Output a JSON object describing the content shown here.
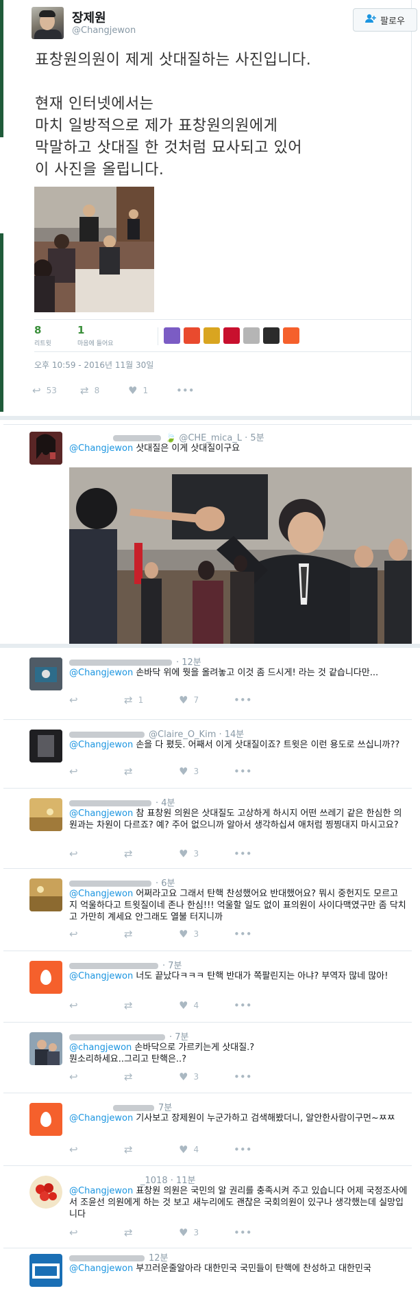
{
  "main_tweet": {
    "author_name": "장제원",
    "author_handle": "@Changjewon",
    "follow_label": "팔로우",
    "paragraph1": "표창원의원이 제게 삿대질하는 사진입니다.",
    "paragraph2": "현재 인터넷에서는\n마치 일방적으로 제가 표창원의원에게\n막말하고 삿대질 한 것처럼 묘사되고 있어\n이 사진을 올립니다.",
    "retweets_count": "8",
    "retweets_label": "리트윗",
    "likes_count": "1",
    "likes_label": "마음에 들어요",
    "timestamp": "오후 10:59 - 2016년 11월 30일",
    "action_reply_count": "53",
    "action_retweet_count": "8",
    "action_like_count": "1",
    "more": "•••",
    "liker_colors": [
      "#7b5cc4",
      "#e94a2e",
      "#d9a520",
      "#c8102e",
      "#b5b5b5",
      "#2b2b2b",
      "#f5602c"
    ]
  },
  "reply1": {
    "handle": "@CHE_mica_L · 5분",
    "mention": "@Changjewon",
    "text": " 삿대질은 이게 삿대질이구요"
  },
  "replies": [
    {
      "handle": "· 12분",
      "mention": "@Changjewon",
      "text": " 손바닥 위에 뭣을 올려놓고 이것 좀 드시게! 라는 것 같습니다만...",
      "retweets": "1",
      "likes": "7"
    },
    {
      "handle": "@Claire_O_Kim · 14분",
      "mention": "@Changjewon",
      "text": " 손을 다 폈듯. 어째서 이게 삿대질이죠? 트윗은 이런 용도로 쓰십니까??",
      "retweets": "",
      "likes": "3"
    },
    {
      "handle": "· 4분",
      "mention": "@Changjewon",
      "text": " 참 표창원 의원은 삿대질도 고상하게 하시지 어떤 쓰레기 같은 한심한 의원과는 차원이 다르죠? 예? 주어 없으니까 알아서 생각하십셔 애처럼 찡찡대지 마시고요?",
      "retweets": "",
      "likes": "3"
    },
    {
      "handle": "· 6분",
      "mention": "@Changjewon",
      "text": " 어쩌라고요 그래서 탄핵 찬성했어요 반대했어요? 뭐시 중헌지도 모르고 지 억울하다고 트윗질이네 존나 한심!!! 억울할 일도 없이 표의원이 사이다맥였구만 좀 닥치고 가만히 계세요 안그래도 열불 터지니까",
      "retweets": "",
      "likes": "3"
    },
    {
      "handle": "· 7분",
      "mention": "@Changjewon",
      "text": " 너도 끝났다ㅋㅋㅋ 탄핵 반대가 쪽팔린지는 아냐? 부역자 많네 많아!",
      "retweets": "",
      "likes": "4"
    },
    {
      "handle": "· 7분",
      "mention": "@changjewon",
      "text": " 손바닥으로 가르키는게 삿대질.?\n뭔소리하세요..그리고 탄핵은..?",
      "retweets": "",
      "likes": "3"
    },
    {
      "handle": "7분",
      "mention": "@Changjewon",
      "text": " 기사보고 장제원이 누군가하고 검색해봤더니, 알안한사람이구먼~ㅉㅉ",
      "retweets": "",
      "likes": "4"
    },
    {
      "handle": "_1018 · 11분",
      "mention": "@Changjewon",
      "text": " 표창원 의원은 국민의 알 권리를 충족시켜 주고 있습니다 어제 국정조사에서 조윤선 의원에게 하는 것 보고 새누리에도 괜찮은 국회의원이 있구나 생각했는데 실망입니다",
      "retweets": "",
      "likes": "3"
    },
    {
      "handle": "12분",
      "mention": "@Changjewon",
      "text": " 부끄러운줄알아라 대한민국 국민들이 탄핵에 찬성하고 대한민국",
      "retweets": "",
      "likes": ""
    }
  ]
}
